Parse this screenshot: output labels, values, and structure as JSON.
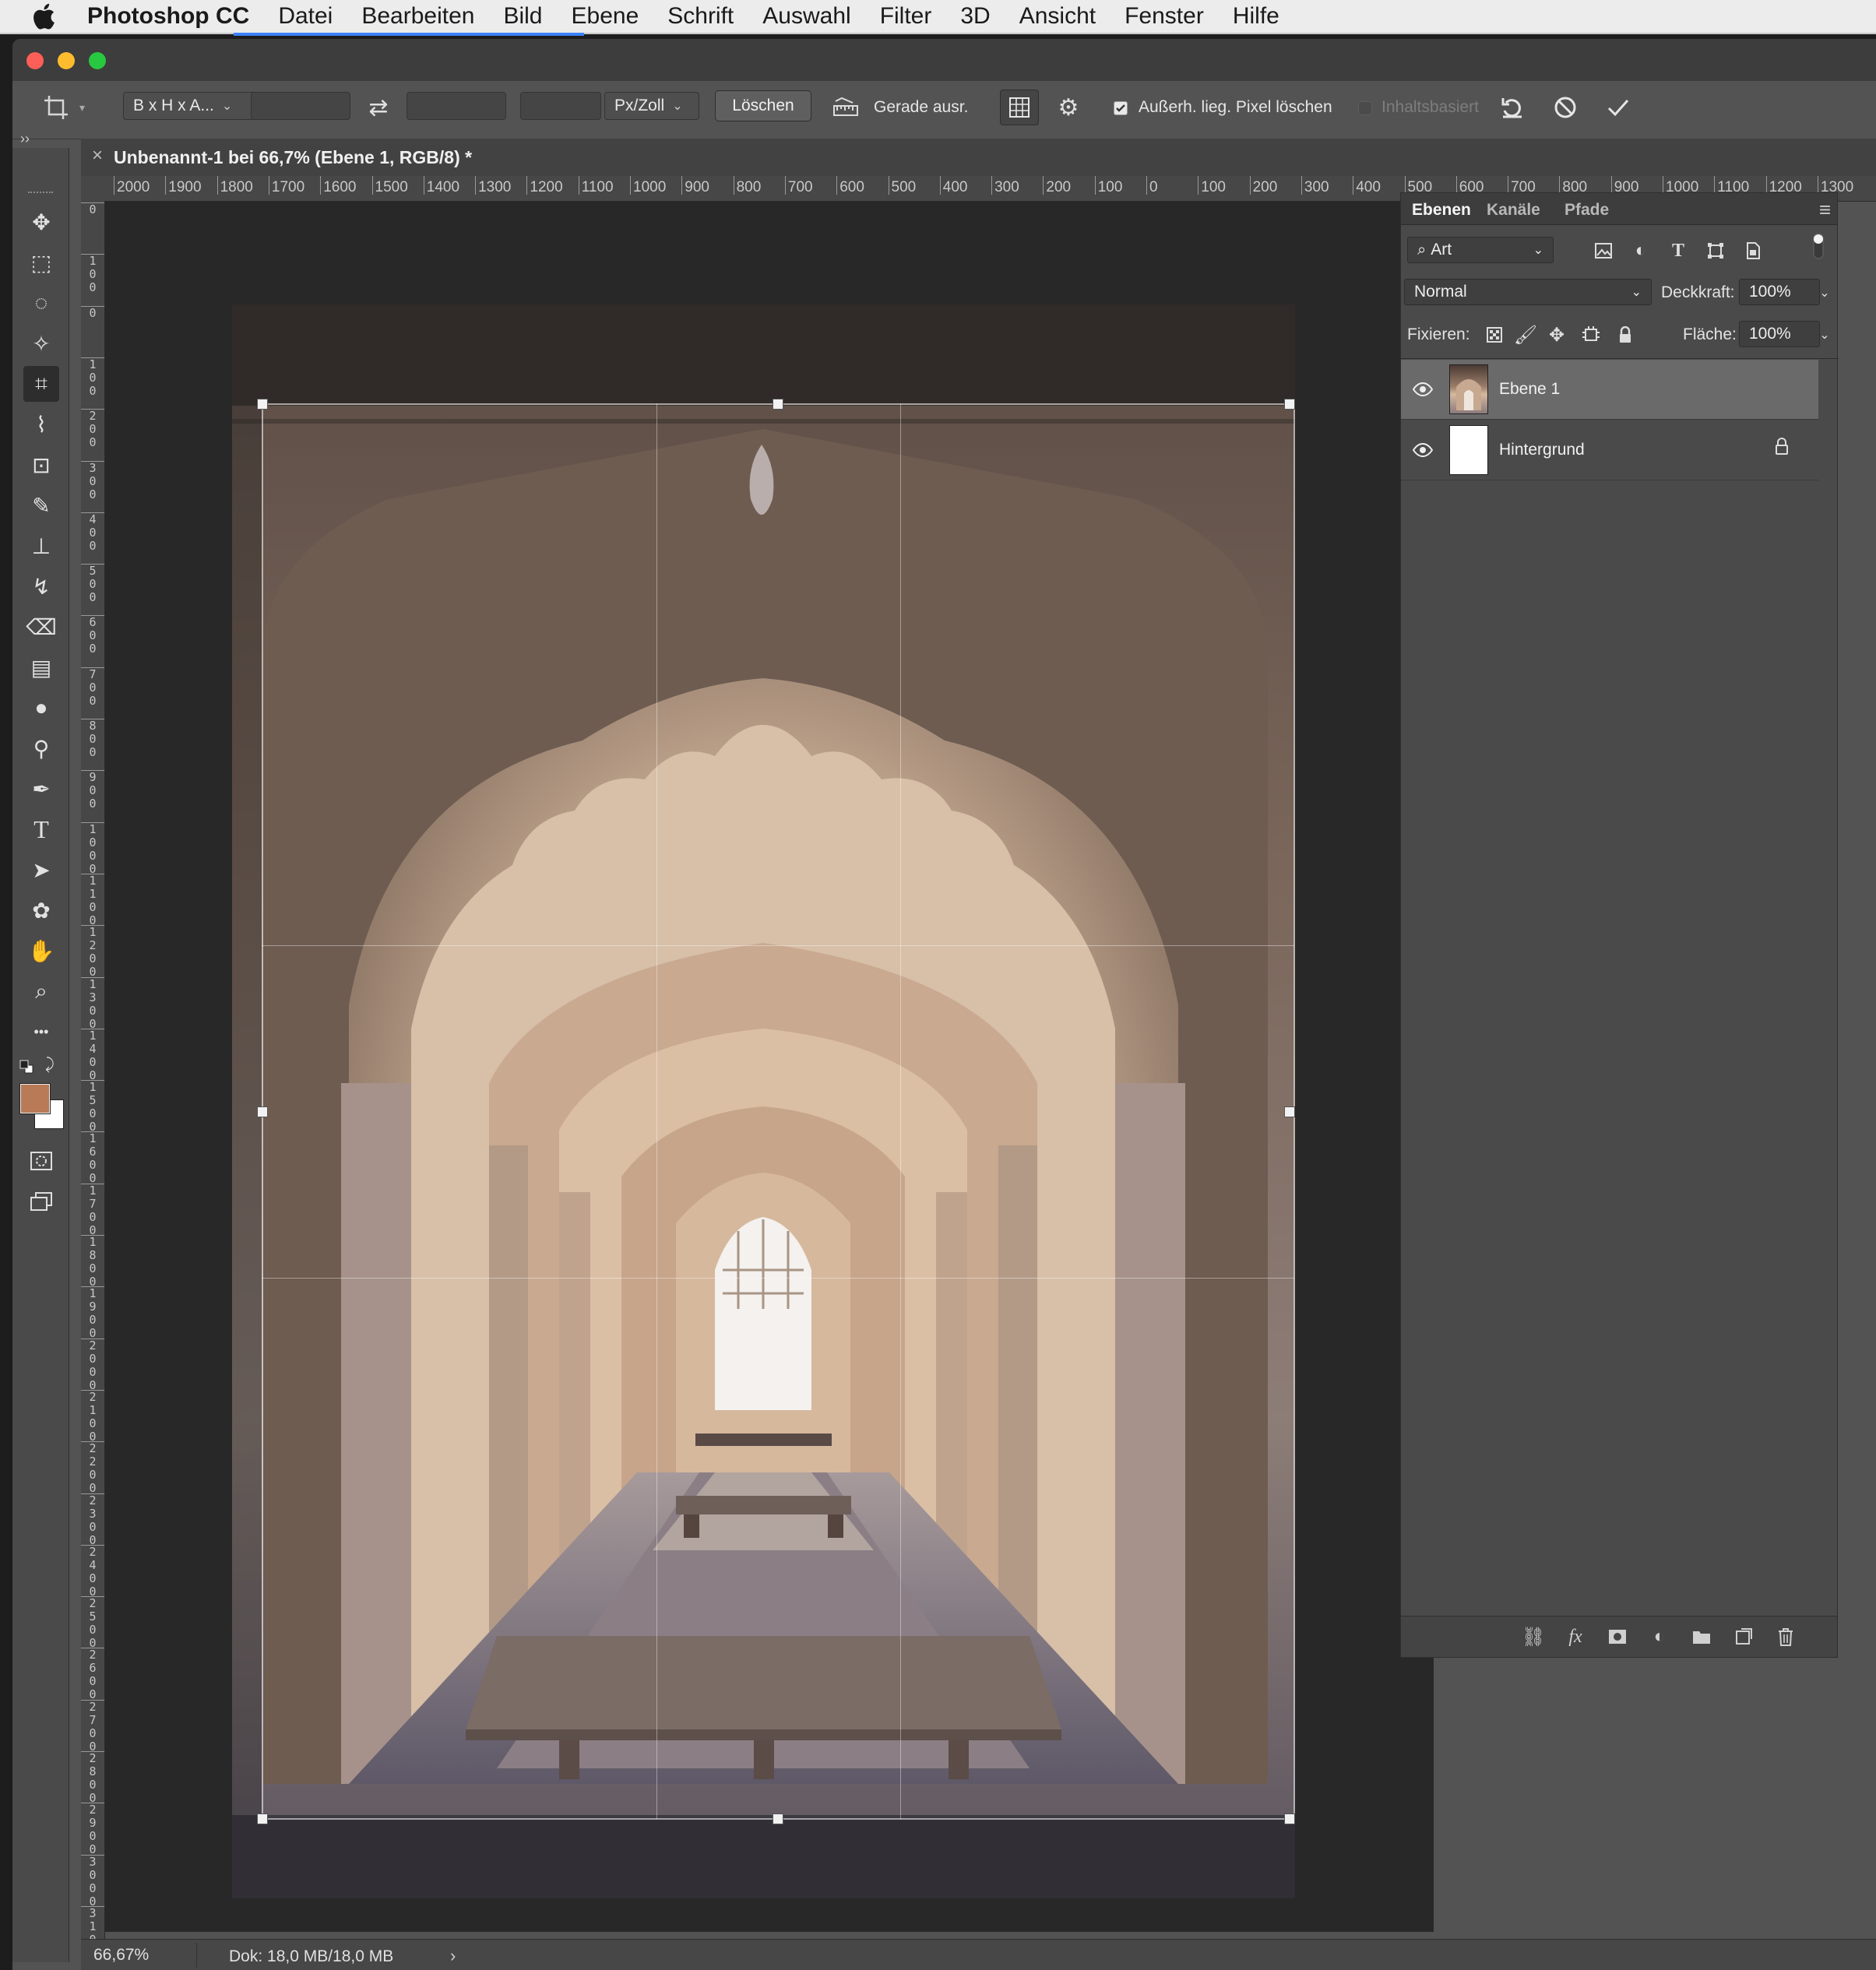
{
  "menubar": {
    "app_name": "Photoshop CC",
    "items": [
      "Datei",
      "Bearbeiten",
      "Bild",
      "Ebene",
      "Schrift",
      "Auswahl",
      "Filter",
      "3D",
      "Ansicht",
      "Fenster",
      "Hilfe"
    ]
  },
  "options_bar": {
    "ratio_preset": "B x H x A...",
    "width_value": "",
    "height_value": "",
    "resolution_value": "",
    "resolution_unit": "Px/Zoll",
    "clear_button": "Löschen",
    "straighten_label": "Gerade ausr.",
    "delete_cropped_pixels": {
      "label": "Außerh. lieg. Pixel löschen",
      "checked": true
    },
    "content_aware": {
      "label": "Inhaltsbasiert",
      "checked": false,
      "enabled": false
    }
  },
  "document_tab": {
    "title": "Unbenannt-1 bei 66,7% (Ebene 1, RGB/8) *"
  },
  "ruler_top": [
    "2000",
    "1900",
    "1800",
    "1700",
    "1600",
    "1500",
    "1400",
    "1300",
    "1200",
    "1100",
    "1000",
    "900",
    "800",
    "700",
    "600",
    "500",
    "400",
    "300",
    "200",
    "100",
    "0",
    "100",
    "200",
    "300",
    "400",
    "500",
    "600",
    "700",
    "800",
    "900",
    "1000",
    "1100",
    "1200",
    "1300"
  ],
  "ruler_left": [
    "0",
    "100",
    "0",
    "100",
    "200",
    "300",
    "400",
    "500",
    "600",
    "700",
    "800",
    "900",
    "1000",
    "1100",
    "1200",
    "1300",
    "1400",
    "1500",
    "1600",
    "1700",
    "1800",
    "1900",
    "2000",
    "2100",
    "2200",
    "2300",
    "2400",
    "2500",
    "2600",
    "2700",
    "2800",
    "2900",
    "3000",
    "3100"
  ],
  "toolbar": {
    "tools": [
      "move",
      "marquee",
      "lasso",
      "magic-wand",
      "crop",
      "eyedropper",
      "spot-healing",
      "brush",
      "clone-stamp",
      "history-brush",
      "eraser",
      "gradient",
      "blur",
      "dodge",
      "pen",
      "type",
      "path-selection",
      "custom-shape",
      "hand",
      "zoom",
      "more"
    ],
    "active_tool": "crop",
    "foreground_color": "#b87a57",
    "background_color": "#ffffff"
  },
  "layers_panel": {
    "tabs": [
      "Ebenen",
      "Kanäle",
      "Pfade"
    ],
    "active_tab": "Ebenen",
    "filter_kind": "Art",
    "blend_mode": "Normal",
    "opacity_label": "Deckkraft:",
    "opacity_value": "100%",
    "lock_label": "Fixieren:",
    "fill_label": "Fläche:",
    "fill_value": "100%",
    "layers": [
      {
        "name": "Ebene 1",
        "visible": true,
        "selected": true,
        "locked": false
      },
      {
        "name": "Hintergrund",
        "visible": true,
        "selected": false,
        "locked": true
      }
    ]
  },
  "status_bar": {
    "zoom": "66,67%",
    "doc_info": "Dok: 18,0 MB/18,0 MB"
  },
  "colors": {
    "menubar_bg": "#ececec",
    "window_bg": "#535353",
    "panel_bg": "#4a4a4a",
    "canvas_bg": "#282828",
    "selected_layer_bg": "#6a6a6a",
    "accent": "#3b82f6"
  }
}
